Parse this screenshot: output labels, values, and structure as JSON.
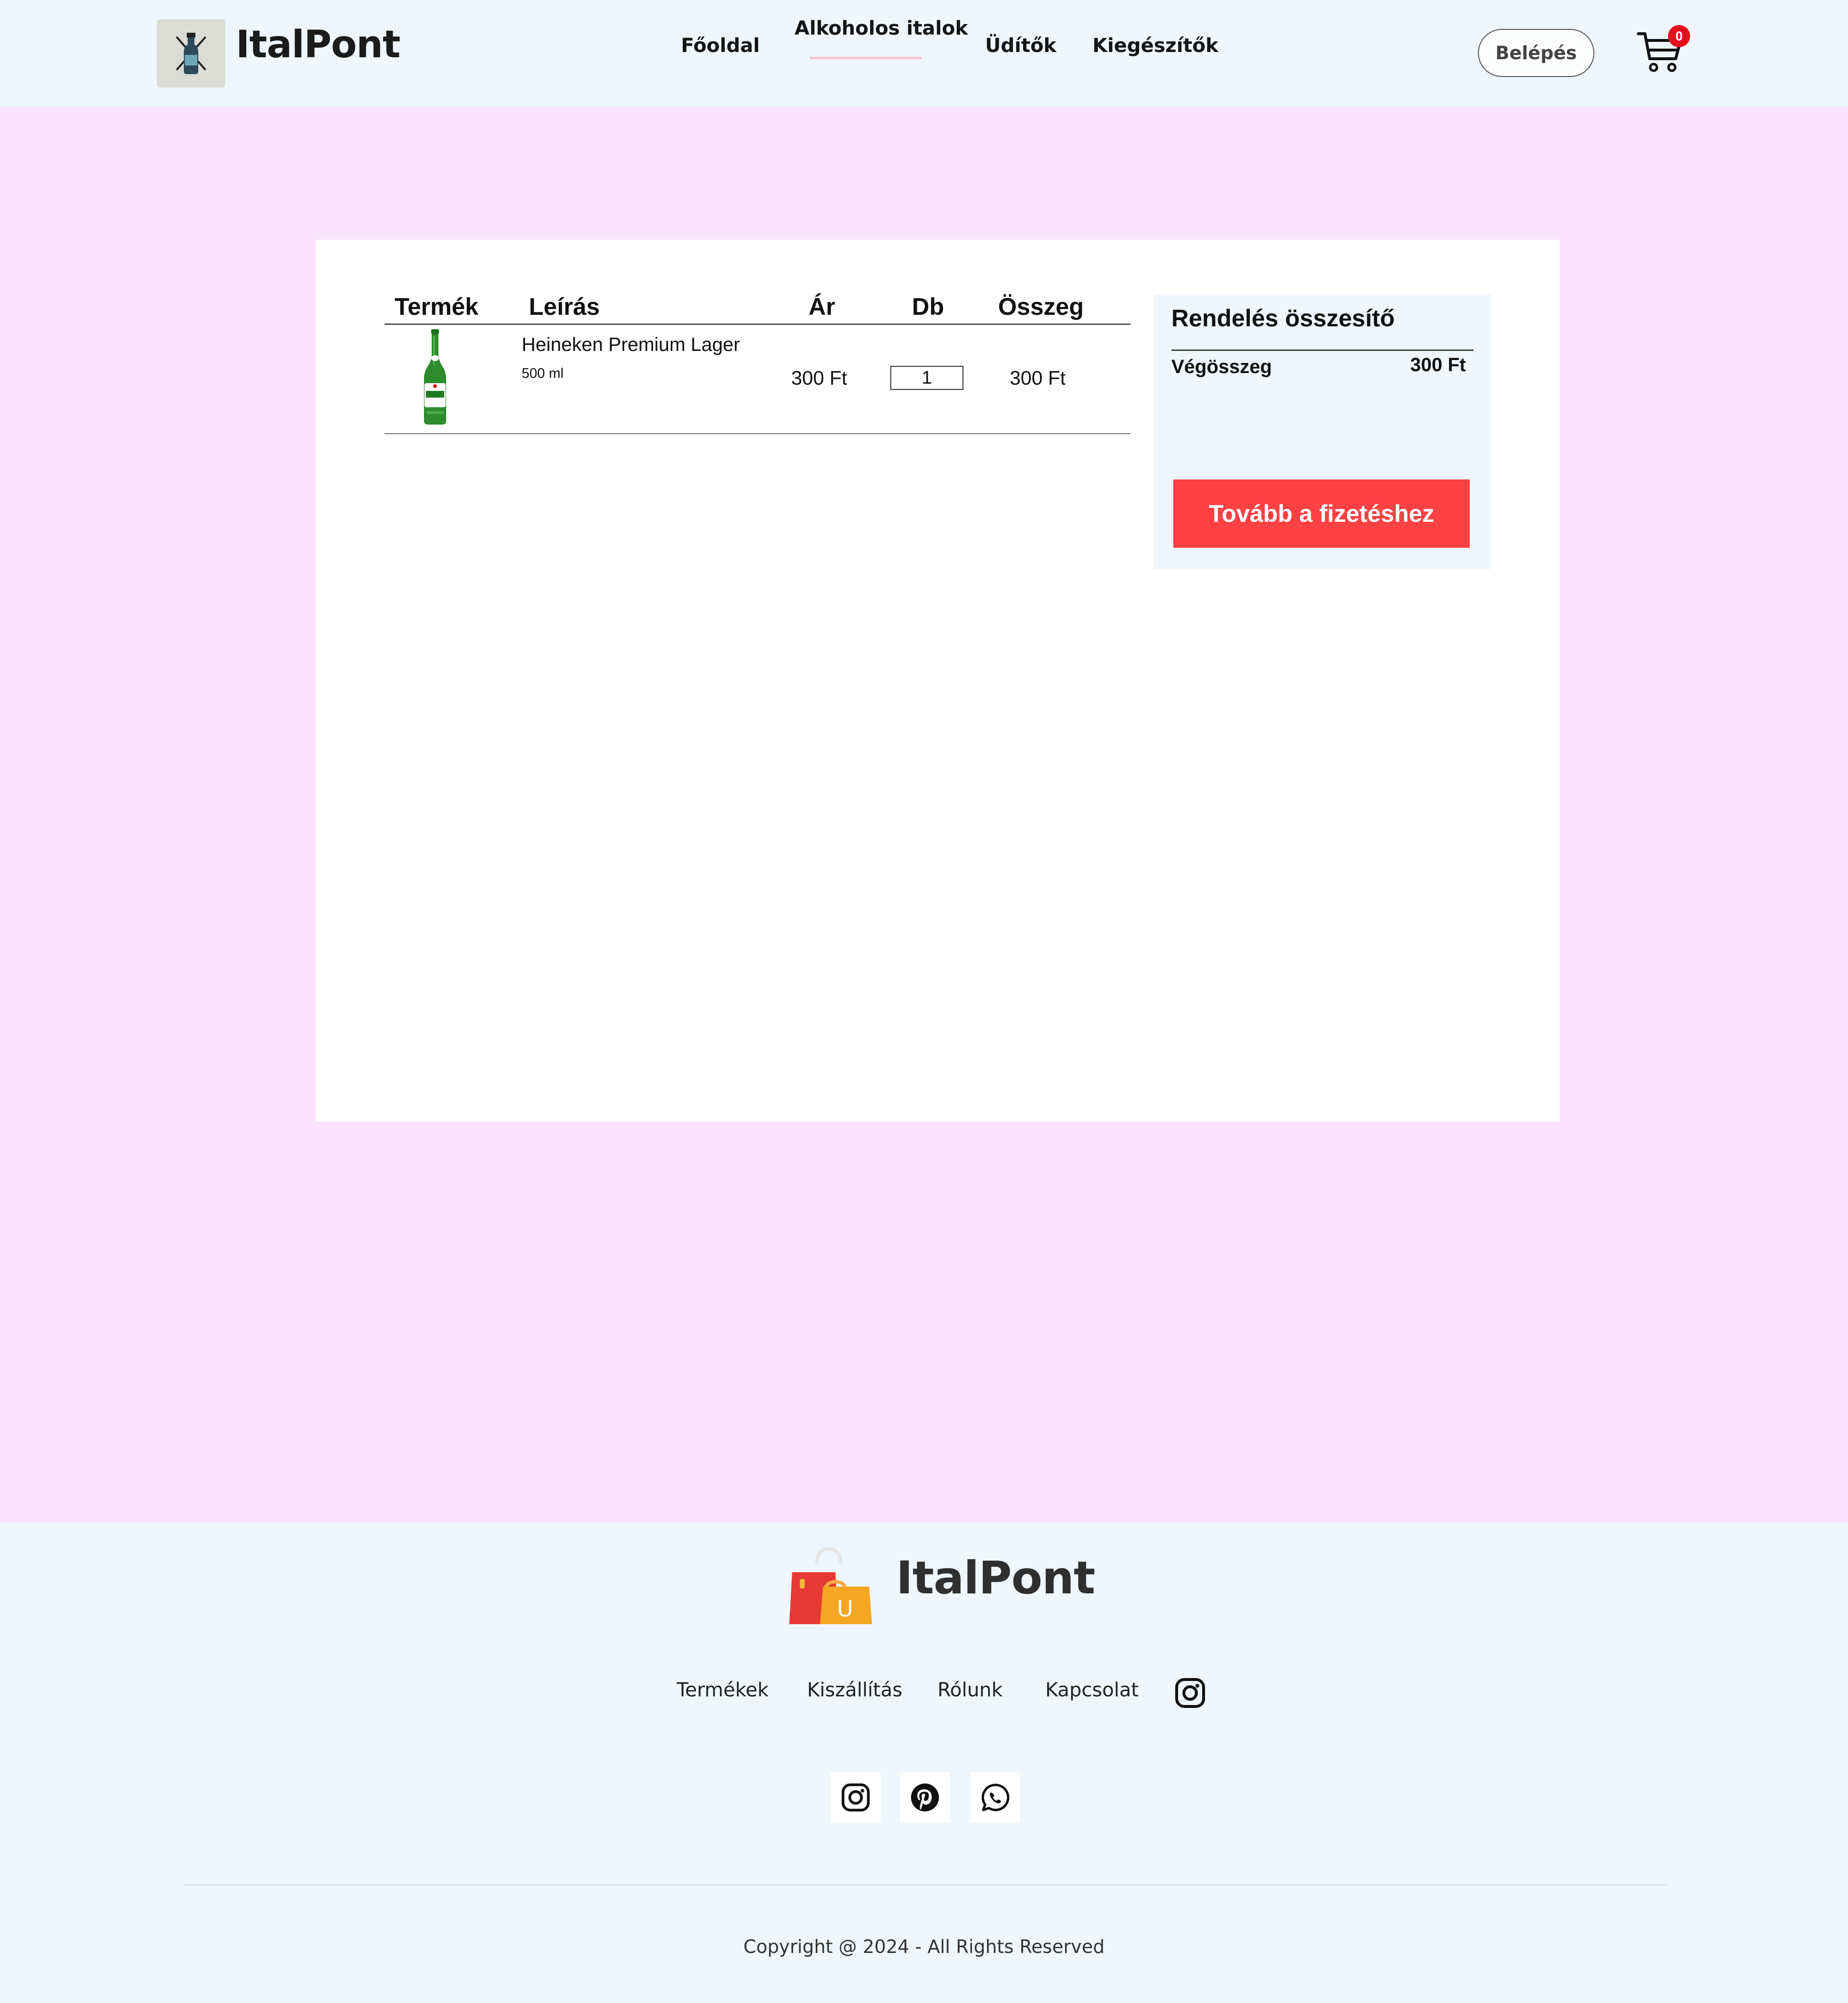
{
  "header": {
    "brand": "ItalPont",
    "nav": [
      {
        "label": "Főoldal"
      },
      {
        "label": "Alkoholos italok"
      },
      {
        "label": "Üdítők"
      },
      {
        "label": "Kiegészítők"
      }
    ],
    "active_nav": "Alkoholos italok",
    "login_label": "Belépés",
    "cart_count": "0",
    "icons": {
      "logo": "bottles-logo-icon",
      "cart": "cart-icon"
    }
  },
  "cart": {
    "columns": {
      "product": "Termék",
      "description": "Leírás",
      "price": "Ár",
      "quantity": "Db",
      "total": "Összeg"
    },
    "items": [
      {
        "name": "Heineken Premium Lager",
        "volume": "500 ml",
        "price": "300 Ft",
        "quantity": "1",
        "total": "300 Ft",
        "image_icon": "beer-bottle-icon"
      }
    ]
  },
  "summary": {
    "title": "Rendelés összesítő",
    "total_label": "Végösszeg",
    "total_value": "300 Ft",
    "checkout_label": "Tovább a fizetéshez"
  },
  "footer": {
    "brand": "ItalPont",
    "links": [
      {
        "label": "Termékek"
      },
      {
        "label": "Kiszállítás"
      },
      {
        "label": "Rólunk"
      },
      {
        "label": "Kapcsolat"
      }
    ],
    "social_icons": [
      "instagram-icon",
      "pinterest-icon",
      "whatsapp-icon"
    ],
    "copyright": "Copyright @ 2024 - All Rights Reserved"
  },
  "colors": {
    "page_bg": "#fae3fd",
    "header_bg": "#eff6fe",
    "accent": "#fe4143",
    "badge": "#e80f1f",
    "nav_underline": "#f3c3cb"
  }
}
